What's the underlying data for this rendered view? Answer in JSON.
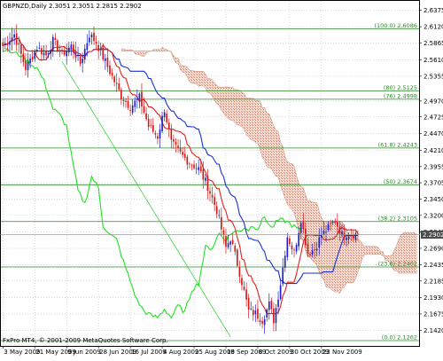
{
  "chart_data": {
    "type": "candlestick",
    "symbol_label": "GBPNZD,Daily  2.3051 2.3051 2.2815 2.2902",
    "footer": "FxPro MT4, © 2001-2009 MetaQuotes Software Corp.",
    "current_price": "2.2902",
    "current_price_value": 2.2902,
    "ylim": [
      2.118,
      2.652
    ],
    "y_ticks": [
      2.6375,
      2.612,
      2.5865,
      2.561,
      2.5355,
      2.497,
      2.4725,
      2.447,
      2.421,
      2.3955,
      2.3705,
      2.345,
      2.32,
      2.2942,
      2.269,
      2.2435,
      2.2185,
      2.193,
      2.1675,
      2.142
    ],
    "y_tick_labels": [
      "2.6375",
      "2.6120",
      "2.5865",
      "2.5610",
      "2.5355",
      "2.4970",
      "2.4725",
      "2.4470",
      "2.4210",
      "2.3955",
      "2.3705",
      "2.3450",
      "2.3200",
      "2.2942",
      "2.2690",
      "2.2435",
      "2.2185",
      "2.1930",
      "2.1675",
      "2.1420"
    ],
    "x_tick_labels": [
      "3 May 2009",
      "21 May 2009",
      "9 Jun 2009",
      "28 Jun 2009",
      "16 Jul 2009",
      "4 Aug 2009",
      "25 Aug 2009",
      "16 Sep 2009",
      "8 Oct 2009",
      "30 Oct 2009",
      "23 Nov 2009"
    ],
    "x_tick_index": [
      0,
      14,
      28,
      42,
      56,
      70,
      84,
      98,
      112,
      126,
      140
    ],
    "n_bars": 157,
    "cloud_extends_bars": 26,
    "fibonacci_levels": [
      {
        "label": "(100.0) 2.6086",
        "value": 2.6086
      },
      {
        "label": "(80) 2.5125",
        "value": 2.5125
      },
      {
        "label": "(76) 2.4998",
        "value": 2.4998
      },
      {
        "label": "(61.8) 2.4243",
        "value": 2.4243
      },
      {
        "label": "(50) 2.3674",
        "value": 2.3674
      },
      {
        "label": "(38.2) 2.3105",
        "value": 2.3105
      },
      {
        "label": "(23.6) 2.2402",
        "value": 2.2402
      },
      {
        "label": "(0.0) 2.1262",
        "value": 2.1262
      }
    ],
    "trendline": {
      "from": {
        "bar": 26,
        "price": 2.558
      },
      "to": {
        "bar": 100,
        "price": 2.132
      }
    },
    "colors": {
      "bull_candle": "#1f22c8",
      "bear_candle": "#d11a1a",
      "tenkan_line": "#e02020",
      "kijun_line": "#1830d0",
      "chikou_line": "#22e022",
      "cloud_fill": "#f4d6cc",
      "cloud_hatch": "#c86a4a",
      "fib_line": "#2a8a2a",
      "trendline": "#22d022",
      "grid": "#a8b4c4",
      "price_badge": "#4a4a4a"
    },
    "price_anchors": [
      [
        0,
        2.582
      ],
      [
        5,
        2.6
      ],
      [
        10,
        2.548
      ],
      [
        15,
        2.58
      ],
      [
        19,
        2.568
      ],
      [
        22,
        2.59
      ],
      [
        26,
        2.57
      ],
      [
        30,
        2.582
      ],
      [
        34,
        2.555
      ],
      [
        38,
        2.6
      ],
      [
        41,
        2.588
      ],
      [
        44,
        2.565
      ],
      [
        48,
        2.535
      ],
      [
        52,
        2.505
      ],
      [
        56,
        2.488
      ],
      [
        60,
        2.502
      ],
      [
        64,
        2.458
      ],
      [
        68,
        2.442
      ],
      [
        71,
        2.485
      ],
      [
        74,
        2.432
      ],
      [
        78,
        2.415
      ],
      [
        82,
        2.402
      ],
      [
        86,
        2.392
      ],
      [
        90,
        2.365
      ],
      [
        94,
        2.328
      ],
      [
        98,
        2.27
      ],
      [
        100,
        2.285
      ],
      [
        104,
        2.232
      ],
      [
        108,
        2.172
      ],
      [
        111,
        2.168
      ],
      [
        114,
        2.158
      ],
      [
        117,
        2.182
      ],
      [
        119,
        2.158
      ],
      [
        122,
        2.215
      ],
      [
        125,
        2.288
      ],
      [
        128,
        2.262
      ],
      [
        131,
        2.315
      ],
      [
        134,
        2.262
      ],
      [
        137,
        2.268
      ],
      [
        140,
        2.29
      ],
      [
        143,
        2.3
      ],
      [
        146,
        2.312
      ],
      [
        149,
        2.29
      ],
      [
        152,
        2.292
      ],
      [
        156,
        2.2902
      ]
    ],
    "chikou_anchors": [
      [
        0,
        2.578
      ],
      [
        4,
        2.572
      ],
      [
        8,
        2.568
      ],
      [
        12,
        2.555
      ],
      [
        15,
        2.548
      ],
      [
        18,
        2.528
      ],
      [
        20,
        2.508
      ],
      [
        22,
        2.485
      ],
      [
        25,
        2.475
      ],
      [
        28,
        2.458
      ],
      [
        30,
        2.415
      ],
      [
        33,
        2.358
      ],
      [
        36,
        2.338
      ],
      [
        39,
        2.38
      ],
      [
        42,
        2.362
      ],
      [
        44,
        2.305
      ],
      [
        47,
        2.29
      ],
      [
        50,
        2.282
      ],
      [
        53,
        2.248
      ],
      [
        56,
        2.218
      ],
      [
        59,
        2.188
      ],
      [
        62,
        2.172
      ],
      [
        65,
        2.165
      ],
      [
        68,
        2.162
      ],
      [
        71,
        2.175
      ],
      [
        74,
        2.162
      ],
      [
        77,
        2.18
      ],
      [
        80,
        2.17
      ],
      [
        83,
        2.205
      ],
      [
        86,
        2.215
      ],
      [
        89,
        2.27
      ],
      [
        92,
        2.27
      ],
      [
        95,
        2.292
      ],
      [
        98,
        2.282
      ],
      [
        101,
        2.295
      ],
      [
        104,
        2.295
      ],
      [
        106,
        2.302
      ],
      [
        108,
        2.298
      ],
      [
        110,
        2.305
      ],
      [
        112,
        2.3
      ],
      [
        115,
        2.318
      ],
      [
        118,
        2.3
      ],
      [
        121,
        2.312
      ],
      [
        124,
        2.312
      ],
      [
        127,
        2.305
      ],
      [
        129,
        2.3
      ],
      [
        131,
        2.295
      ]
    ]
  }
}
